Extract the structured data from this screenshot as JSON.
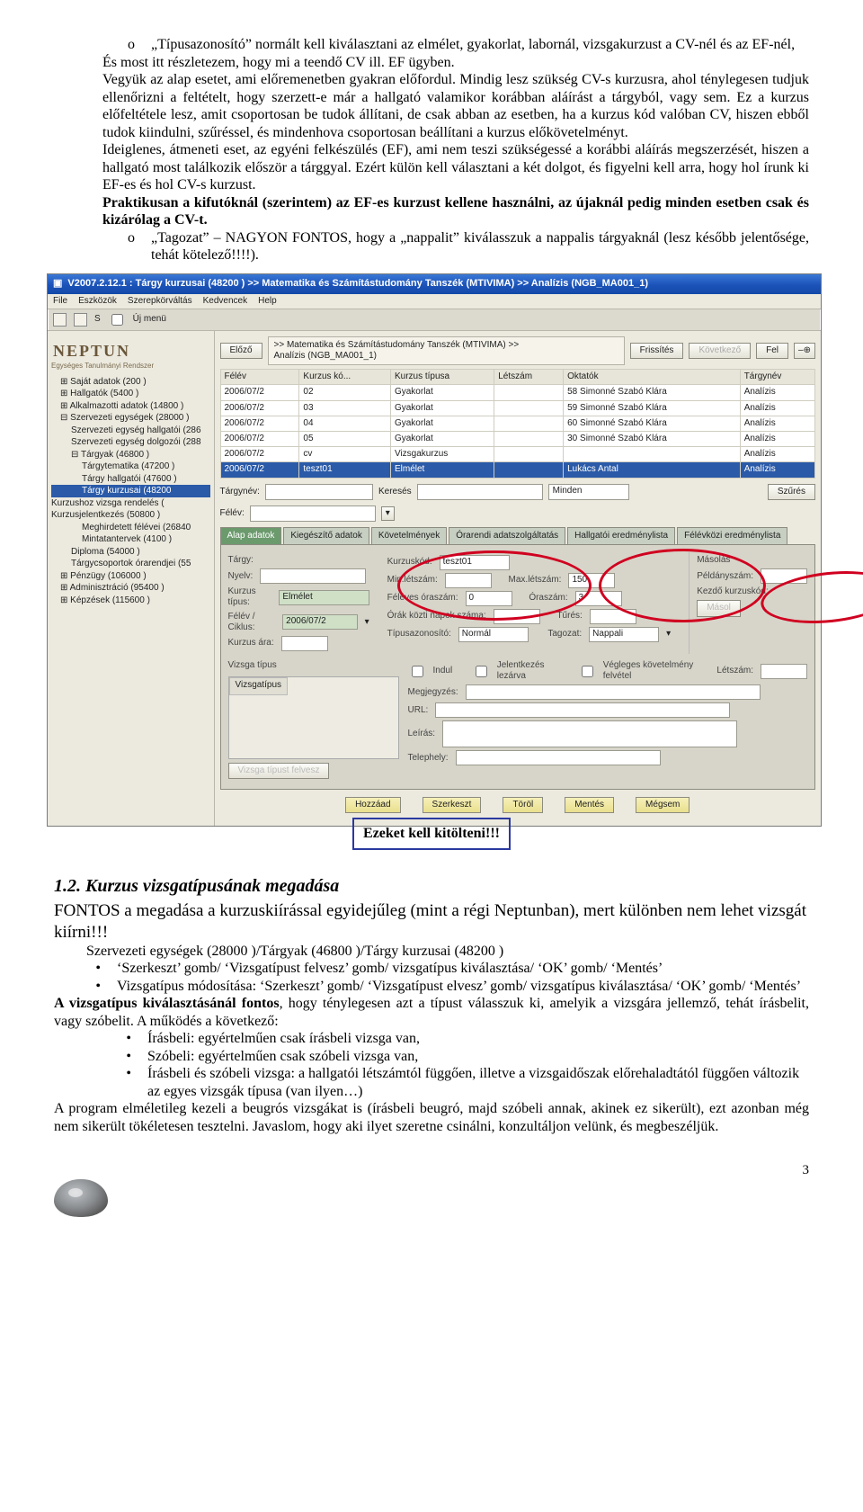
{
  "top_text": {
    "b1_first": "„Típusazonosító” normált kell kiválasztani az elmélet, gyakorlat, labornál, vizsgakurzust a CV-nél és az EF-nél,",
    "b1_rest": "És most itt részletezem, hogy mi a teendő CV ill. EF ügyben.\nVegyük az alap esetet, ami előremenetben gyakran előfordul. Mindig lesz szükség CV-s kurzusra, ahol ténylegesen tudjuk ellenőrizni a feltételt, hogy szerzett-e már a hallgató valamikor korábban aláírást a tárgyból, vagy sem. Ez a kurzus előfeltétele lesz, amit csoportosan be tudok állítani, de csak abban az esetben, ha a kurzus kód valóban CV, hiszen ebből tudok kiindulni, szűréssel, és mindenhova csoportosan beállítani a kurzus előkövetelményt.\nIdeiglenes, átmeneti eset, az egyéni felkészülés (EF), ami nem teszi szükségessé a korábbi aláírás megszerzését, hiszen a hallgató most találkozik először a tárggyal. Ezért külön kell választani a két dolgot, és figyelni kell arra, hogy hol írunk ki EF-es és hol CV-s kurzust.",
    "b1_bold": "Praktikusan a kifutóknál (szerintem) az EF-es kurzust kellene használni, az újaknál pedig minden esetben csak és kizárólag a CV-t.",
    "b2_first": "„Tagozat” – NAGYON FONTOS, hogy a „nappalit” kiválasszuk a nappalis tárgyaknál (lesz később jelentősége, tehát kötelező!!!!).",
    "callout": "Ezeket kell kitölteni!!!"
  },
  "section": {
    "title": "1.2.   Kurzus vizsgatípusának megadása",
    "p1": "FONTOS a megadása a kurzuskiírással egyidejűleg (mint a régi Neptunban), mert különben nem lehet vizsgát kiírni!!!",
    "p2": "Szervezeti egységek (28000 )/Tárgyak (46800 )/Tárgy kurzusai (48200 )",
    "li1": "‘Szerkeszt’ gomb/ ‘Vizsgatípust felvesz’ gomb/ vizsgatípus kiválasztása/ ‘OK’ gomb/ ‘Mentés’",
    "li2": "Vizsgatípus módosítása: ‘Szerkeszt’ gomb/ ‘Vizsgatípust elvesz’ gomb/ vizsgatípus kiválasztása/ ‘OK’ gomb/ ‘Mentés’",
    "p3a": "A vizsgatípus kiválasztásánál fontos",
    "p3b": ", hogy ténylegesen azt a típust válasszuk ki, amelyik a vizsgára jellemző, tehát írásbelit, vagy szóbelit. A működés a következő:",
    "sub1": "Írásbeli: egyértelműen csak írásbeli vizsga van,",
    "sub2": "Szóbeli: egyértelműen csak szóbeli vizsga van,",
    "sub3": "Írásbeli és szóbeli vizsga: a hallgatói létszámtól függően, illetve a vizsgaidőszak előrehaladtától függően változik az egyes vizsgák típusa (van ilyen…)",
    "p4": "A program elméletileg kezeli a beugrós vizsgákat is (írásbeli beugró, majd szóbeli annak, akinek ez sikerült), ezt azonban még nem sikerült tökéletesen tesztelni. Javaslom, hogy aki ilyet szeretne csinálni, konzultáljon velünk, és megbeszéljük."
  },
  "page": "3",
  "shot": {
    "title": "V2007.2.12.1 : Tárgy kurzusai (48200 )  >> Matematika és Számítástudomány Tanszék (MTIVIMA) >> Analízis (NGB_MA001_1)",
    "menu": [
      "File",
      "Eszközök",
      "Szerepkörváltás",
      "Kedvencek",
      "Help"
    ],
    "toolbar_label": "Új menü",
    "logo": "NEPTUN",
    "logo_tag": "Egységes Tanulmányi Rendszer",
    "tree": [
      {
        "t": "Saját adatok (200 )",
        "lvl": 0
      },
      {
        "t": "Hallgatók (5400 )",
        "lvl": 0
      },
      {
        "t": "Alkalmazotti adatok (14800 )",
        "lvl": 0
      },
      {
        "t": "Szervezeti egységek (28000 )",
        "lvl": 0,
        "open": true
      },
      {
        "t": "Szervezeti egység hallgatói (286",
        "lvl": 1
      },
      {
        "t": "Szervezeti egység dolgozói (288",
        "lvl": 1
      },
      {
        "t": "Tárgyak (46800 )",
        "lvl": 1,
        "open": true
      },
      {
        "t": "Tárgytematika (47200 )",
        "lvl": 2
      },
      {
        "t": "Tárgy hallgatói (47600 )",
        "lvl": 2
      },
      {
        "t": "Tárgy kurzusai (48200",
        "lvl": 2,
        "sel": true
      },
      {
        "t": "Kurzushoz vizsga rendelés (",
        "lvl": 3
      },
      {
        "t": "Kurzusjelentkezés (50800 )",
        "lvl": 3
      },
      {
        "t": "Meghirdetett félévei (26840",
        "lvl": 2
      },
      {
        "t": "Mintatantervek (4100 )",
        "lvl": 2
      },
      {
        "t": "Diploma (54000 )",
        "lvl": 1
      },
      {
        "t": "Tárgycsoportok órarendjei (55",
        "lvl": 1
      },
      {
        "t": "Pénzügy (106000 )",
        "lvl": 0
      },
      {
        "t": "Adminisztráció (95400 )",
        "lvl": 0
      },
      {
        "t": "Képzések (115600 )",
        "lvl": 0
      }
    ],
    "nav_btns": {
      "prev": "Előző",
      "refresh": "Frissítés",
      "next": "Következő",
      "up": "Fel"
    },
    "crumb": ">> Matematika és Számítástudomány Tanszék (MTIVIMA) >>\nAnalízis (NGB_MA001_1)",
    "grid_cols": [
      "Félév",
      "Kurzus kó...",
      "Kurzus típusa",
      "Létszám",
      "Oktatók",
      "Tárgynév"
    ],
    "grid_rows": [
      [
        "2006/07/2",
        "02",
        "Gyakorlat",
        "",
        "58 Simonné Szabó Klára",
        "Analízis"
      ],
      [
        "2006/07/2",
        "03",
        "Gyakorlat",
        "",
        "59 Simonné Szabó Klára",
        "Analízis"
      ],
      [
        "2006/07/2",
        "04",
        "Gyakorlat",
        "",
        "60 Simonné Szabó Klára",
        "Analízis"
      ],
      [
        "2006/07/2",
        "05",
        "Gyakorlat",
        "",
        "30 Simonné Szabó Klára",
        "Analízis"
      ],
      [
        "2006/07/2",
        "cv",
        "Vizsgakurzus",
        "",
        "",
        "Analízis"
      ],
      [
        "2006/07/2",
        "teszt01",
        "Elmélet",
        "",
        "Lukács Antal",
        "Analízis"
      ]
    ],
    "filters": {
      "targynev": "Tárgynév:",
      "kereses": "Keresés",
      "minden": "Minden",
      "szures": "Szűrés"
    },
    "semester_label": "Félév:",
    "tabs": [
      "Alap adatok",
      "Kiegészítő adatok",
      "Követelmények",
      "Órarendi adatszolgáltatás",
      "Hallgatói eredménylista",
      "Félévközi eredménylista"
    ],
    "panel": {
      "targy": "Tárgy:",
      "nyelv": "Nyelv:",
      "kurzus_tip": "Kurzus típus:",
      "kurzus_tip_v": "Elmélet",
      "felev": "Félév / Ciklus:",
      "felev_v": "2006/07/2",
      "kurzus_ara": "Kurzus ára:",
      "kod": "Kurzuskód:",
      "kod_v": "teszt01",
      "min": "Min.létszám:",
      "max": "Max.létszám:",
      "max_v": "150",
      "feleves": "Féléves óraszám:",
      "feleves_v": "0",
      "oraszam": "Óraszám:",
      "oraszam_v": "3",
      "orakszam": "Órák közti napok száma:",
      "tures": "Tűrés:",
      "tipus": "Típusazonosító:",
      "tipus_v": "Normál",
      "tagozat": "Tagozat:",
      "tagozat_v": "Nappali",
      "masolas": "Másolás",
      "peldany": "Példányszám:",
      "kezdo": "Kezdő kurzuskód:",
      "masol": "Másol",
      "indul": "Indul",
      "lezarva": "Jelentkezés lezárva",
      "felvetel": "Végleges követelmény felvétel",
      "letszam": "Létszám:",
      "megj": "Megjegyzés:",
      "url": "URL:",
      "leiras": "Leírás:",
      "telep": "Telephely:",
      "vizsga": "Vizsga típus",
      "vizsga_col": "Vizsgatípus",
      "vt_btn": "Vizsga típust felvesz"
    },
    "bottom_btns": [
      "Hozzáad",
      "Szerkeszt",
      "Töröl",
      "Mentés",
      "Mégsem"
    ]
  }
}
